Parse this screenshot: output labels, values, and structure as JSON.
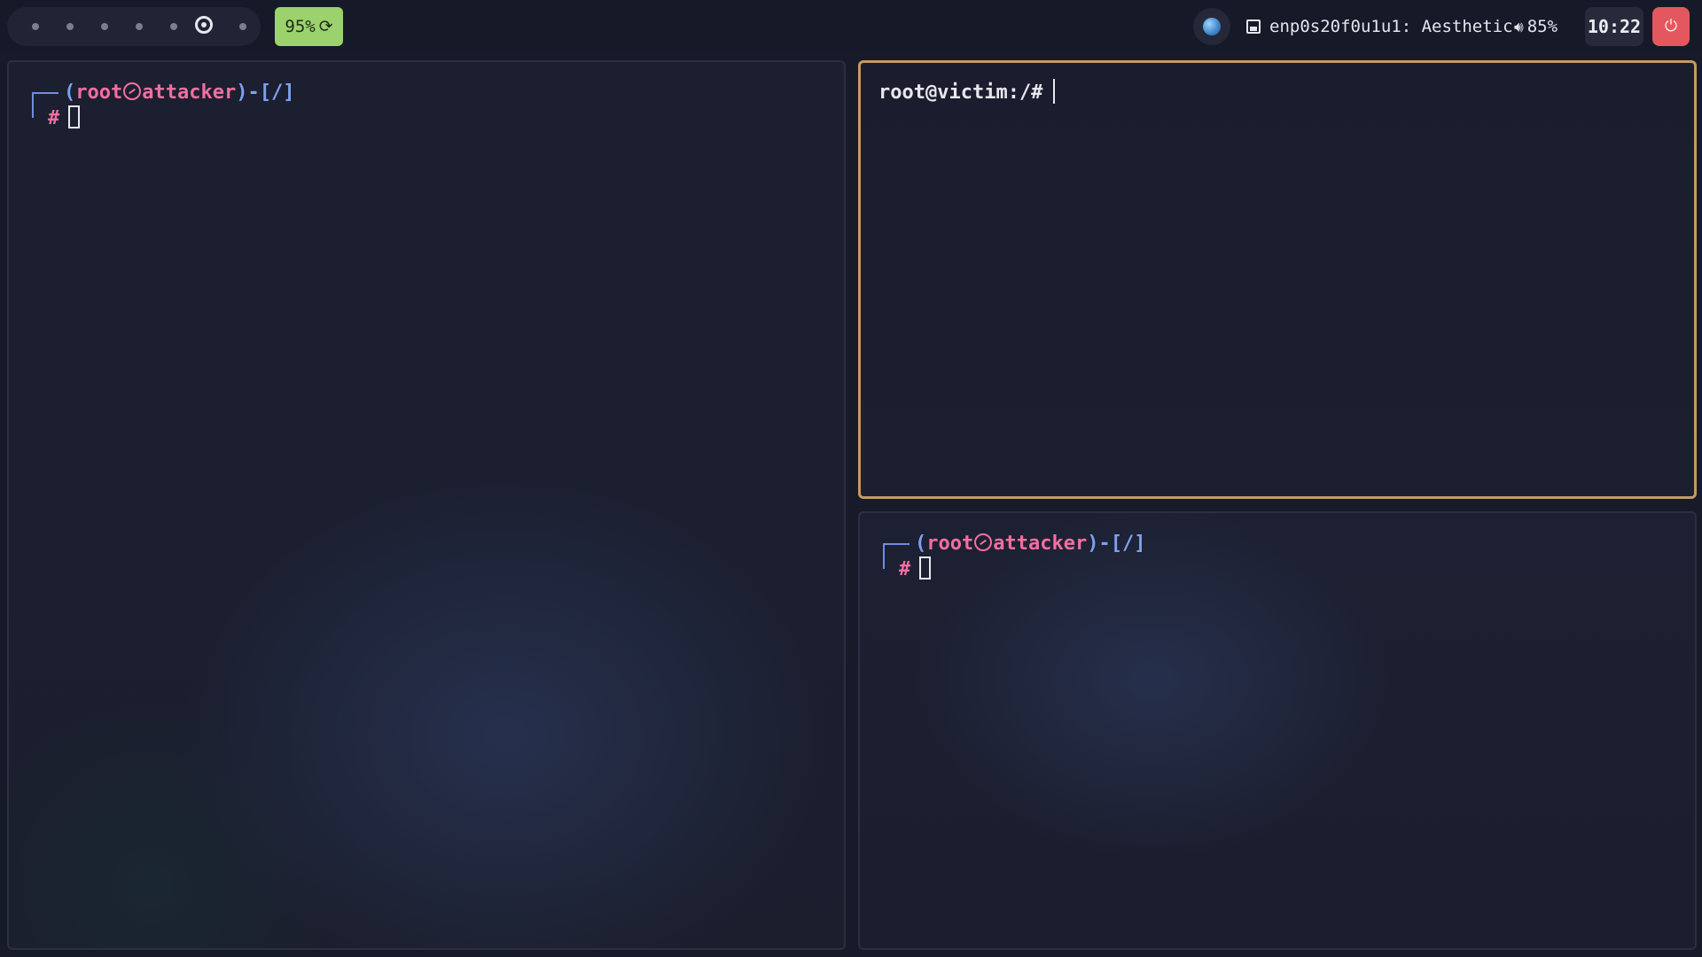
{
  "topbar": {
    "workspaces": {
      "count": 7,
      "active_index": 5
    },
    "battery": {
      "label": "95%",
      "icon": "refresh-icon",
      "color": "#9bd26e"
    },
    "tray": {
      "icon": "globe-icon"
    },
    "network": {
      "icon": "ethernet-icon",
      "label": "enp0s20f0u1u1: Aesthetic"
    },
    "volume": {
      "icon": "speaker-icon",
      "label": "85%"
    },
    "clock": {
      "label": "10:22"
    },
    "power": {
      "icon": "power-icon",
      "color": "#e3585f"
    }
  },
  "terminals": [
    {
      "id": "left",
      "prompt": {
        "open": "(",
        "user": "root",
        "host": "attacker",
        "close": ")",
        "dash": "-",
        "cwd": "[/]",
        "symbol": "#"
      }
    },
    {
      "id": "top-right",
      "focused": true,
      "border_color": "#c49a63",
      "prompt_text": "root@victim:/#"
    },
    {
      "id": "bottom-right",
      "prompt": {
        "open": "(",
        "user": "root",
        "host": "attacker",
        "close": ")",
        "dash": "-",
        "cwd": "[/]",
        "symbol": "#"
      }
    }
  ]
}
